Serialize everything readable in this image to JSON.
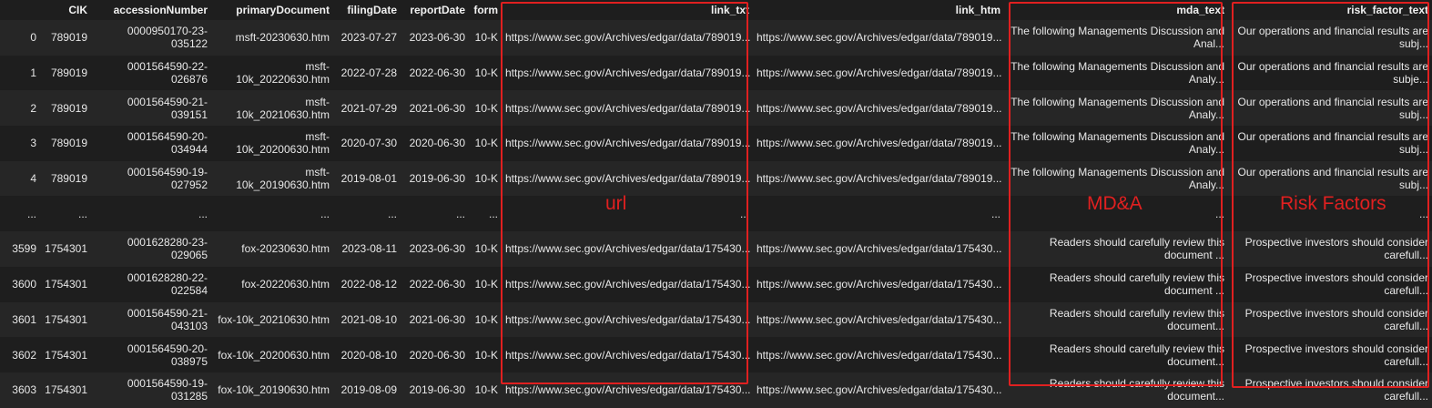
{
  "columns": [
    "",
    "CIK",
    "accessionNumber",
    "primaryDocument",
    "filingDate",
    "reportDate",
    "form",
    "link_txt",
    "link_htm",
    "mda_text",
    "risk_factor_text"
  ],
  "rows": [
    [
      "0",
      "789019",
      "0000950170-23-035122",
      "msft-20230630.htm",
      "2023-07-27",
      "2023-06-30",
      "10-K",
      "https://www.sec.gov/Archives/edgar/data/789019...",
      "https://www.sec.gov/Archives/edgar/data/789019...",
      "The following Managements Discussion and Anal...",
      "Our operations and financial results are subj..."
    ],
    [
      "1",
      "789019",
      "0001564590-22-026876",
      "msft-10k_20220630.htm",
      "2022-07-28",
      "2022-06-30",
      "10-K",
      "https://www.sec.gov/Archives/edgar/data/789019...",
      "https://www.sec.gov/Archives/edgar/data/789019...",
      "The following Managements Discussion and Analy...",
      "Our operations and financial results are subje..."
    ],
    [
      "2",
      "789019",
      "0001564590-21-039151",
      "msft-10k_20210630.htm",
      "2021-07-29",
      "2021-06-30",
      "10-K",
      "https://www.sec.gov/Archives/edgar/data/789019...",
      "https://www.sec.gov/Archives/edgar/data/789019...",
      "The following Managements Discussion and Analy...",
      "Our operations and financial results are subj..."
    ],
    [
      "3",
      "789019",
      "0001564590-20-034944",
      "msft-10k_20200630.htm",
      "2020-07-30",
      "2020-06-30",
      "10-K",
      "https://www.sec.gov/Archives/edgar/data/789019...",
      "https://www.sec.gov/Archives/edgar/data/789019...",
      "The following Managements Discussion and Analy...",
      "Our operations and financial results are subj..."
    ],
    [
      "4",
      "789019",
      "0001564590-19-027952",
      "msft-10k_20190630.htm",
      "2019-08-01",
      "2019-06-30",
      "10-K",
      "https://www.sec.gov/Archives/edgar/data/789019...",
      "https://www.sec.gov/Archives/edgar/data/789019...",
      "The following Managements Discussion and Analy...",
      "Our operations and financial results are subj..."
    ],
    [
      "...",
      "...",
      "...",
      "...",
      "...",
      "...",
      "...",
      "...",
      "...",
      "...",
      "..."
    ],
    [
      "3599",
      "1754301",
      "0001628280-23-029065",
      "fox-20230630.htm",
      "2023-08-11",
      "2023-06-30",
      "10-K",
      "https://www.sec.gov/Archives/edgar/data/175430...",
      "https://www.sec.gov/Archives/edgar/data/175430...",
      "Readers should carefully review this document ...",
      "Prospective investors should consider carefull..."
    ],
    [
      "3600",
      "1754301",
      "0001628280-22-022584",
      "fox-20220630.htm",
      "2022-08-12",
      "2022-06-30",
      "10-K",
      "https://www.sec.gov/Archives/edgar/data/175430...",
      "https://www.sec.gov/Archives/edgar/data/175430...",
      "Readers should carefully review this document ...",
      "Prospective investors should consider carefull..."
    ],
    [
      "3601",
      "1754301",
      "0001564590-21-043103",
      "fox-10k_20210630.htm",
      "2021-08-10",
      "2021-06-30",
      "10-K",
      "https://www.sec.gov/Archives/edgar/data/175430...",
      "https://www.sec.gov/Archives/edgar/data/175430...",
      "Readers should carefully review this document...",
      "Prospective investors should consider carefull..."
    ],
    [
      "3602",
      "1754301",
      "0001564590-20-038975",
      "fox-10k_20200630.htm",
      "2020-08-10",
      "2020-06-30",
      "10-K",
      "https://www.sec.gov/Archives/edgar/data/175430...",
      "https://www.sec.gov/Archives/edgar/data/175430...",
      "Readers should carefully review this document...",
      "Prospective investors should consider carefull..."
    ],
    [
      "3603",
      "1754301",
      "0001564590-19-031285",
      "fox-10k_20190630.htm",
      "2019-08-09",
      "2019-06-30",
      "10-K",
      "https://www.sec.gov/Archives/edgar/data/175430...",
      "https://www.sec.gov/Archives/edgar/data/175430...",
      "Readers should carefully review this document...",
      "Prospective investors should consider carefull..."
    ]
  ],
  "annotations": {
    "url": "url",
    "mda": "MD&A",
    "risk": "Risk Factors"
  },
  "colors": {
    "background": "#1e1e1e",
    "row_alt": "#262626",
    "highlight": "#e02020",
    "text": "#e8e8e8"
  }
}
